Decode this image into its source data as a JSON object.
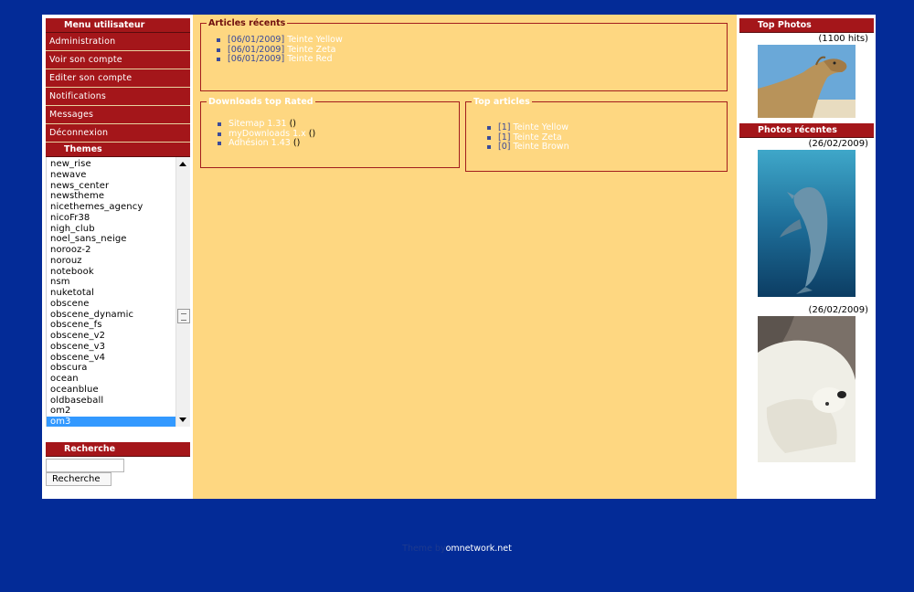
{
  "menu": {
    "title": "Menu utilisateur",
    "items": [
      {
        "label": "Administration"
      },
      {
        "label": "Voir son compte"
      },
      {
        "label": "Editer son compte"
      },
      {
        "label": "Notifications"
      },
      {
        "label": "Messages"
      },
      {
        "label": "Déconnexion"
      }
    ]
  },
  "themes": {
    "title": "Themes",
    "items": [
      "new_rise",
      "newave",
      "news_center",
      "newstheme",
      "nicethemes_agency",
      "nicoFr38",
      "nigh_club",
      "noel_sans_neige",
      "norooz-2",
      "norouz",
      "notebook",
      "nsm",
      "nuketotal",
      "obscene",
      "obscene_dynamic",
      "obscene_fs",
      "obscene_v2",
      "obscene_v3",
      "obscene_v4",
      "obscura",
      "ocean",
      "oceanblue",
      "oldbaseball",
      "om2",
      "om3"
    ],
    "selected": "om3"
  },
  "search": {
    "title": "Recherche",
    "input_value": "",
    "button_label": "Recherche"
  },
  "recent_articles": {
    "title": "Articles récents",
    "items": [
      {
        "date": "[06/01/2009]",
        "title": "Teinte Yellow"
      },
      {
        "date": "[06/01/2009]",
        "title": "Teinte Zeta"
      },
      {
        "date": "[06/01/2009]",
        "title": "Teinte Red"
      }
    ]
  },
  "downloads": {
    "title": "Downloads top Rated",
    "items": [
      {
        "title": "Sitemap 1.31",
        "count": "()"
      },
      {
        "title": "myDownloads 1.x",
        "count": "()"
      },
      {
        "title": "Adhésion 1.43",
        "count": "()"
      }
    ]
  },
  "top_articles": {
    "title": "Top articles",
    "items": [
      {
        "count": "[1]",
        "title": "Teinte Yellow"
      },
      {
        "count": "[1]",
        "title": "Teinte Zeta"
      },
      {
        "count": "[0]",
        "title": "Teinte Brown"
      }
    ]
  },
  "top_photos": {
    "title": "Top Photos",
    "caption": "(1100 hits)",
    "photo": "camel-photo"
  },
  "recent_photos": {
    "title": "Photos récentes",
    "photos": [
      {
        "caption": "(26/02/2009)",
        "photo": "dolphin-photo"
      },
      {
        "caption": "(26/02/2009)",
        "photo": "polar-bear-photo"
      }
    ]
  },
  "footer": {
    "prefix": "Theme by",
    "site": "omnetwork.net"
  },
  "colors": {
    "background": "#032b97",
    "block_header": "#a4161a",
    "content_bg": "#fed781",
    "selection": "#3399ff"
  }
}
